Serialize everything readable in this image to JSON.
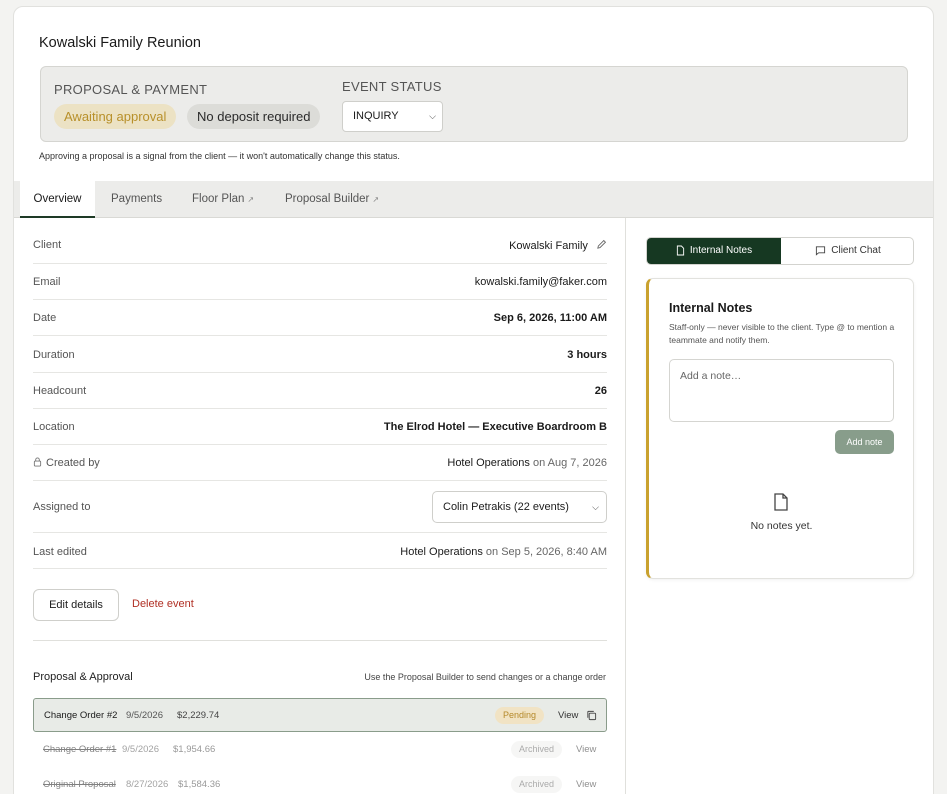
{
  "event": {
    "title": "Kowalski Family Reunion"
  },
  "status_box": {
    "proposal_label": "PROPOSAL & PAYMENT",
    "awaiting_badge": "Awaiting approval",
    "deposit_badge": "No deposit required",
    "event_status_label": "EVENT STATUS",
    "event_status_value": "INQUIRY",
    "hint": "Approving a proposal is a signal from the client — it won't automatically change this status."
  },
  "tabs": [
    {
      "label": "Overview"
    },
    {
      "label": "Payments"
    },
    {
      "label": "Floor Plan"
    },
    {
      "label": "Proposal Builder"
    }
  ],
  "details": {
    "client_label": "Client",
    "client_value": "Kowalski Family",
    "email_label": "Email",
    "email_value": "kowalski.family@faker.com",
    "date_label": "Date",
    "date_value": "Sep 6, 2026, 11:00 AM",
    "duration_label": "Duration",
    "duration_value": "3 hours",
    "headcount_label": "Headcount",
    "headcount_value": "26",
    "location_label": "Location",
    "location_value": "The Elrod Hotel — Executive Boardroom B",
    "created_label": "Created by",
    "created_by": "Hotel Operations",
    "created_on": "on Aug 7, 2026",
    "assigned_label": "Assigned to",
    "assigned_value": "Colin Petrakis (22 events)",
    "edited_label": "Last edited",
    "edited_by": "Hotel Operations",
    "edited_on": "on Sep 5, 2026, 8:40 AM"
  },
  "actions": {
    "edit": "Edit details",
    "delete": "Delete event"
  },
  "proposals": {
    "title": "Proposal & Approval",
    "hint": "Use the Proposal Builder to send changes or a change order",
    "items": [
      {
        "name": "Change Order #2",
        "date": "9/5/2026",
        "amount": "$2,229.74",
        "status": "Pending",
        "view": "View"
      },
      {
        "name": "Change Order #1",
        "date": "9/5/2026",
        "amount": "$1,954.66",
        "status": "Archived",
        "view": "View"
      },
      {
        "name": "Original Proposal",
        "date": "8/27/2026",
        "amount": "$1,584.36",
        "status": "Archived",
        "view": "View"
      }
    ]
  },
  "side": {
    "tab_notes": "Internal Notes",
    "tab_chat": "Client Chat",
    "notes_title": "Internal Notes",
    "notes_desc": "Staff-only — never visible to the client. Type @ to mention a teammate and notify them.",
    "placeholder": "Add a note…",
    "add_button": "Add note",
    "empty": "No notes yet."
  },
  "colors": {
    "accent": "#163822",
    "gold": "#c9a12e",
    "danger": "#b02f24",
    "pending": "#b5892a"
  }
}
